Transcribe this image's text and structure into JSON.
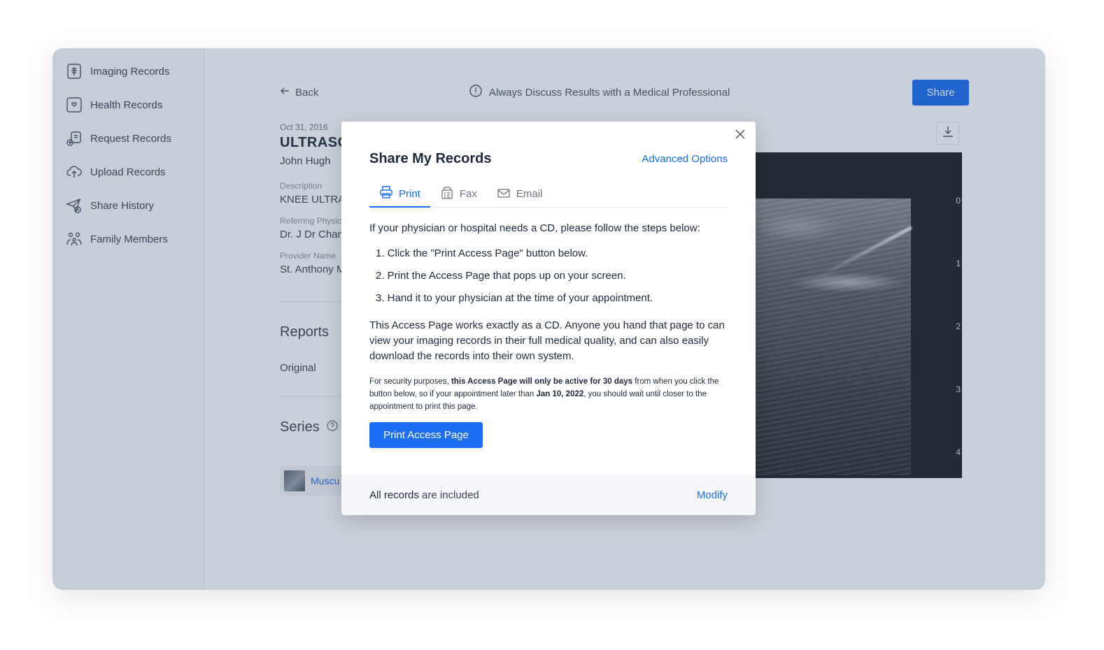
{
  "sidebar": {
    "items": [
      {
        "label": "Imaging Records",
        "icon": "imaging-icon"
      },
      {
        "label": "Health Records",
        "icon": "health-icon"
      },
      {
        "label": "Request Records",
        "icon": "request-icon"
      },
      {
        "label": "Upload Records",
        "icon": "upload-cloud-icon"
      },
      {
        "label": "Share History",
        "icon": "share-history-icon"
      },
      {
        "label": "Family Members",
        "icon": "family-icon"
      }
    ]
  },
  "header": {
    "back_label": "Back",
    "notice": "Always Discuss Results with a Medical Professional",
    "share_label": "Share"
  },
  "study": {
    "date": "Oct 31, 2016",
    "title": "ULTRASC",
    "patient": "John Hugh",
    "description_label": "Description",
    "description": "KNEE ULTRA",
    "referring_label": "Referring Physici",
    "referring": "Dr. J Dr Chan",
    "provider_label": "Provider Name",
    "provider": "St. Anthony M",
    "reports_title": "Reports",
    "reports_item": "Original",
    "series_title": "Series",
    "series_item": "Muscu"
  },
  "viewer": {
    "ruler": [
      "0",
      "1",
      "2",
      "3",
      "4"
    ]
  },
  "modal": {
    "title": "Share My Records",
    "advanced": "Advanced Options",
    "tabs": [
      {
        "label": "Print",
        "icon": "printer-icon"
      },
      {
        "label": "Fax",
        "icon": "fax-icon"
      },
      {
        "label": "Email",
        "icon": "envelope-icon"
      }
    ],
    "intro": "If your physician or hospital needs a CD, please follow the steps below:",
    "steps": [
      "1. Click the \"Print Access Page\" button below.",
      "2. Print the Access Page that pops up on your screen.",
      "3. Hand it to your physician at the time of your appointment."
    ],
    "paragraph": "This Access Page works exactly as a CD. Anyone you hand that page to can view your imaging records in their full medical quality, and can also easily download the records into their own system.",
    "fine_1": "For security purposes, ",
    "fine_bold_1": "this Access Page will only be active for 30 days",
    "fine_2": " from when you click the button below, so if your appointment later than ",
    "fine_bold_2": "Jan 10, 2022",
    "fine_3": ", you should wait until closer to the appointment to print this page.",
    "print_button": "Print Access Page",
    "footer_bold": "All records",
    "footer_rest": " are included",
    "modify": "Modify"
  },
  "colors": {
    "accent": "#1c6ef2",
    "overlay": "#31486b"
  }
}
